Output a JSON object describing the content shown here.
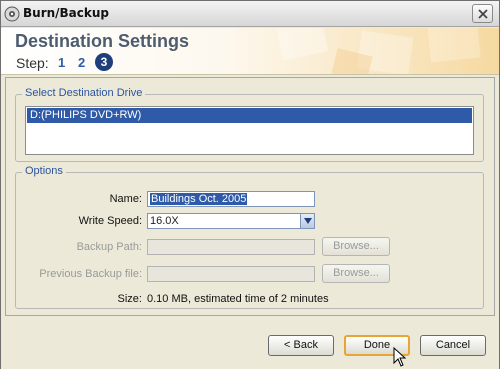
{
  "window": {
    "title": "Burn/Backup"
  },
  "header": {
    "title": "Destination Settings",
    "step_label": "Step:",
    "steps": [
      "1",
      "2",
      "3"
    ],
    "active_step": "3"
  },
  "destination": {
    "legend": "Select Destination Drive",
    "drives": [
      "D:(PHILIPS DVD+RW)"
    ],
    "selected_drive": "D:(PHILIPS DVD+RW)"
  },
  "options": {
    "legend": "Options",
    "name_label": "Name:",
    "name_value": "Buildings Oct. 2005",
    "write_speed_label": "Write Speed:",
    "write_speed_value": "16.0X",
    "backup_path_label": "Backup Path:",
    "backup_path_value": "",
    "previous_backup_label": "Previous Backup file:",
    "previous_backup_value": "",
    "browse_label": "Browse...",
    "size_label": "Size:",
    "size_value": "0.10 MB, estimated time of 2 minutes"
  },
  "footer": {
    "back_label": "< Back",
    "done_label": "Done",
    "cancel_label": "Cancel"
  },
  "colors": {
    "accent": "#2f5aa8",
    "title": "#4d5d6f",
    "default_button_border": "#e8a437"
  }
}
